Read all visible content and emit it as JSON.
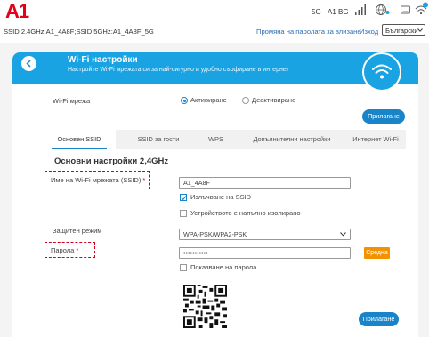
{
  "brand": {
    "logo_text": "A1",
    "accent": "#e2001a"
  },
  "status": {
    "network_type": "5G",
    "operator": "A1 BG"
  },
  "top": {
    "ssid_info": "SSID 2.4GHz:A1_4A8F;SSID 5GHz:A1_4A8F_5G",
    "change_password_link": "Промяна на паролата за влизане",
    "logout_link": "Изход",
    "language_value": "Български"
  },
  "header": {
    "title": "Wi-Fi настройки",
    "subtitle": "Настройте Wi-Fi мрежата си за най-сигурно и удобно сърфиране в интернет",
    "color": "#1aa3e3"
  },
  "wifi": {
    "label": "Wi-Fi мрежа",
    "enable_label": "Активиране",
    "disable_label": "Деактивиране",
    "apply_label": "Прилагане"
  },
  "tabs": [
    {
      "label": "Основен SSID",
      "active": true
    },
    {
      "label": "SSID за гости",
      "active": false
    },
    {
      "label": "WPS",
      "active": false
    },
    {
      "label": "Допълнителни настройки",
      "active": false
    },
    {
      "label": "Интернет Wi-Fi",
      "active": false
    }
  ],
  "basic": {
    "section_title": "Основни настройки 2,4GHz",
    "ssid_label": "Име на Wi-Fi мрежата (SSID)",
    "ssid_value": "A1_4A8F",
    "broadcast_label": "Излъчване на SSID",
    "isolation_label": "Устройството е напълно изолирано",
    "security_label": "Защитен режим",
    "security_value": "WPA-PSK/WPA2-PSK",
    "password_label": "Парола",
    "password_value": "•••••••••••",
    "strength_label": "Средна",
    "show_password_label": "Показване на парола",
    "apply_label": "Прилагане",
    "required_mark": "*"
  }
}
